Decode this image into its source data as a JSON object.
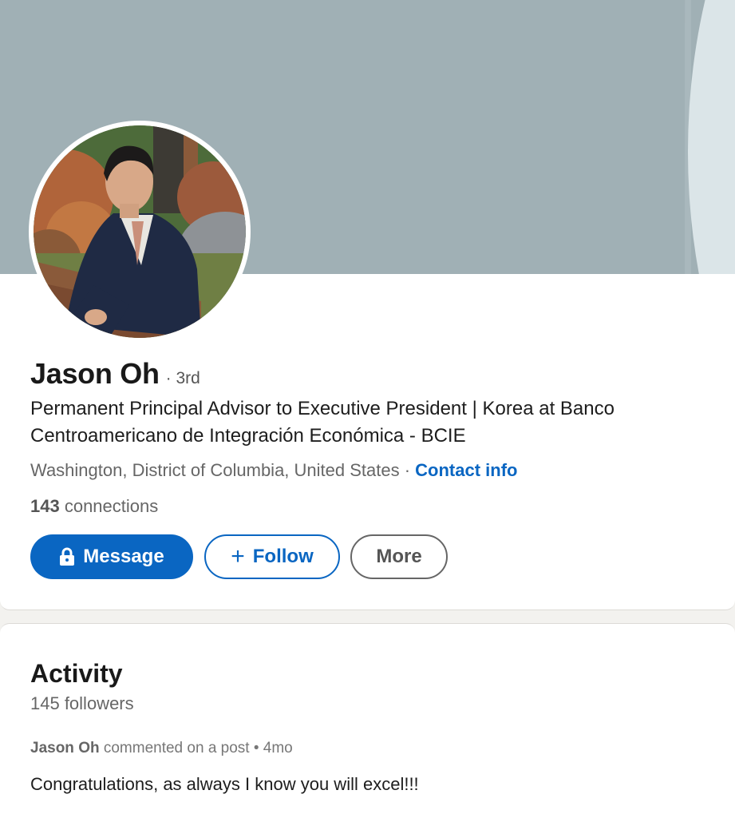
{
  "profile": {
    "name": "Jason Oh",
    "degree": "· 3rd",
    "headline": "Permanent Principal Advisor to Executive President | Korea at Banco Centroamericano de Integración Económica - BCIE",
    "location": "Washington, District of Columbia, United States",
    "separator": " · ",
    "contact_info": "Contact info",
    "connections_count": "143",
    "connections_label": " connections"
  },
  "actions": {
    "message": "Message",
    "follow_plus": "+",
    "follow": "Follow",
    "more": "More"
  },
  "activity": {
    "title": "Activity",
    "followers": "145 followers",
    "post": {
      "author": "Jason Oh",
      "action": " commented on a post • 4mo",
      "text": "Congratulations, as always I know you will excel!!!"
    }
  },
  "icons": {
    "message": "lock-icon"
  },
  "colors": {
    "accent": "#0a66c2",
    "cover": "#a0b0b5"
  }
}
